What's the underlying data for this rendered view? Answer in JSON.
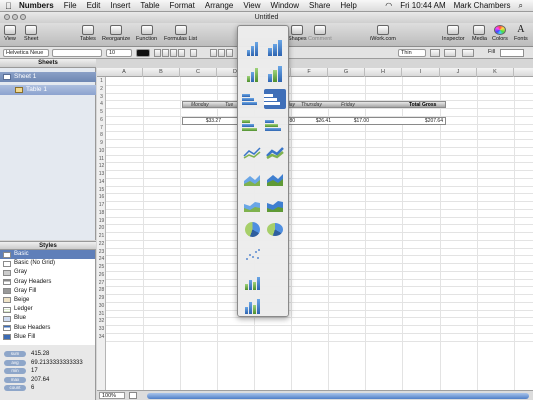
{
  "menubar": {
    "app_name": "Numbers",
    "items": [
      "File",
      "Edit",
      "Insert",
      "Table",
      "Format",
      "Arrange",
      "View",
      "Window",
      "Share",
      "Help"
    ],
    "clock": "Fri 10:44 AM",
    "user": "Mark Chambers"
  },
  "window": {
    "title": "Untitled"
  },
  "toolbar": {
    "view": "View",
    "sheet": "Sheet",
    "tables": "Tables",
    "reorganize": "Reorganize",
    "function": "Function",
    "formulas_list": "Formulas List",
    "shapes": "Shapes",
    "comment": "Comment",
    "iwork": "iWork.com",
    "inspector": "Inspector",
    "media": "Media",
    "colors": "Colors",
    "fonts": "Fonts"
  },
  "formatbar": {
    "font": "Helvetica Neue",
    "size": "10",
    "line": "Thin",
    "fill": "Fill"
  },
  "sheets": {
    "header": "Sheets",
    "sheet1": "Sheet 1",
    "table1": "Table 1"
  },
  "styles": {
    "header": "Styles",
    "items": [
      "Basic",
      "Basic (No Grid)",
      "Gray",
      "Gray Headers",
      "Gray Fill",
      "Beige",
      "Ledger",
      "Blue",
      "Blue Headers",
      "Blue Fill"
    ]
  },
  "stats": [
    {
      "key": "sum",
      "value": "415.28"
    },
    {
      "key": "avg",
      "value": "69.2133333333333"
    },
    {
      "key": "min",
      "value": "17"
    },
    {
      "key": "max",
      "value": "207.64"
    },
    {
      "key": "count",
      "value": "6"
    }
  ],
  "grid": {
    "columns": [
      "A",
      "B",
      "C",
      "D",
      "E",
      "F",
      "G",
      "H",
      "I",
      "J",
      "K"
    ],
    "rows": [
      "1",
      "2",
      "3",
      "4",
      "5",
      "6",
      "7",
      "8",
      "9",
      "10",
      "11",
      "12",
      "13",
      "14",
      "15",
      "16",
      "17",
      "18",
      "19",
      "20",
      "21",
      "22",
      "23",
      "24",
      "25",
      "26",
      "27",
      "28",
      "29",
      "30",
      "31",
      "32",
      "33",
      "34"
    ]
  },
  "table": {
    "headers": {
      "monday": "Monday",
      "tue": "Tue",
      "day": "day",
      "thursday": "Thursday",
      "friday": "Friday",
      "total": "Total Gross"
    },
    "values": {
      "monday": "$33.27",
      "mid": "80",
      "thursday": "$26.41",
      "friday": "$17.00",
      "total": "$207.64"
    }
  },
  "zoom": "100%",
  "colors": {
    "selection": "#3f6fb8",
    "sheet_sel": "#6e87b3"
  }
}
